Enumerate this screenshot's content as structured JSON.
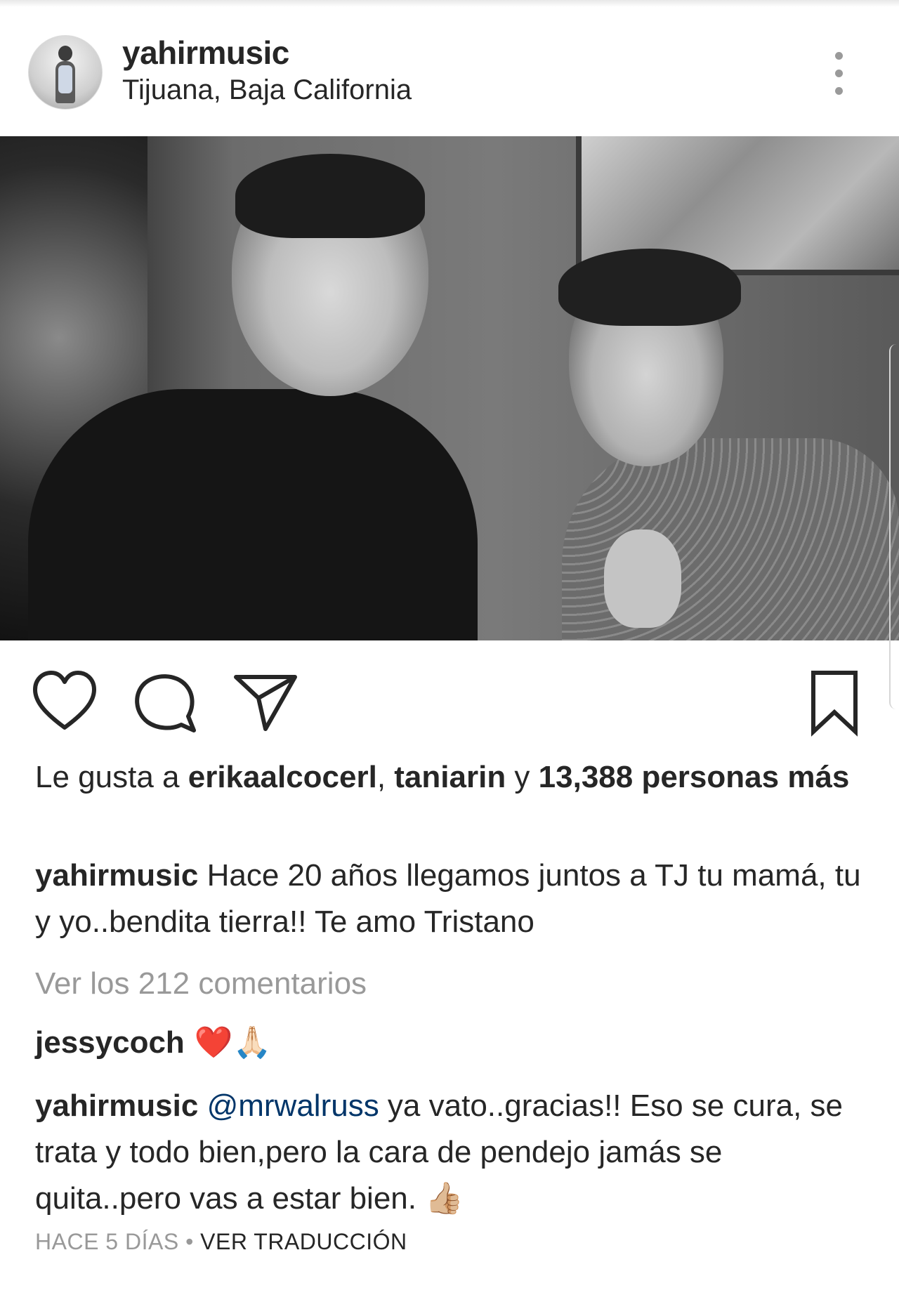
{
  "post": {
    "username": "yahirmusic",
    "location": "Tijuana, Baja California"
  },
  "likes": {
    "prefix": "Le gusta a ",
    "user1": "erikaalcocerl",
    "sep": ", ",
    "user2": "taniarin",
    "conj": " y ",
    "count_text": "13,388 personas más"
  },
  "caption": {
    "username": "yahirmusic",
    "text": " Hace 20 años llegamos juntos a TJ tu mamá, tu y yo..bendita tierra!! Te amo Tristano"
  },
  "view_comments": "Ver los 212 comentarios",
  "comments": [
    {
      "username": "jessycoch",
      "text": " ❤️🙏🏻"
    },
    {
      "username": "yahirmusic",
      "mention": "@mrwalruss",
      "text": " ya vato..gracias!! Eso se cura, se trata y todo bien,pero la cara de pendejo jamás se quita..pero vas a estar bien. 👍🏼"
    }
  ],
  "meta": {
    "time": "HACE 5 DÍAS",
    "dot": " • ",
    "translate": "VER TRADUCCIÓN"
  },
  "icons": {
    "like": "heart-outline-icon",
    "comment": "speech-bubble-icon",
    "share": "paper-plane-icon",
    "save": "bookmark-icon",
    "more": "vertical-dots-icon"
  }
}
